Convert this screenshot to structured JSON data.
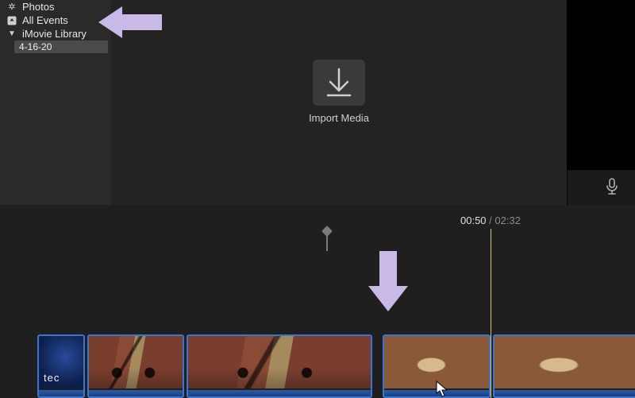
{
  "sidebar": {
    "items": [
      {
        "icon": "photos-icon",
        "label": "Photos"
      },
      {
        "icon": "events-icon",
        "label": "All Events"
      },
      {
        "icon": "library-icon",
        "label": "iMovie Library"
      }
    ],
    "entries": [
      {
        "label": "4-16-20"
      }
    ]
  },
  "import": {
    "label": "Import Media"
  },
  "timeline": {
    "current": "00:50",
    "duration": "02:32"
  },
  "clips": [
    {
      "name": "clip-intro"
    },
    {
      "name": "clip-bike-1"
    },
    {
      "name": "clip-bike-2"
    },
    {
      "name": "clip-hands-1"
    },
    {
      "name": "clip-hands-2"
    }
  ],
  "intro_badge": "tec"
}
